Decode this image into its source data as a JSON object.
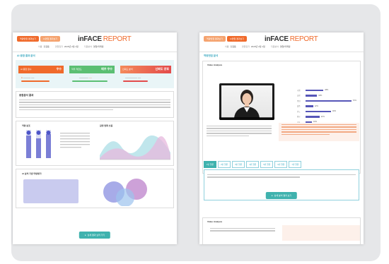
{
  "report": {
    "logo_main": "inFACE",
    "logo_report": "REPORT"
  },
  "left": {
    "tabs": [
      "역량면접 결과보기",
      "AI면접 결과보기"
    ],
    "meta": [
      {
        "k": "이름",
        "v": "홍길동"
      },
      {
        "k": "면접일자",
        "v": "2020년 2월 1일"
      },
      {
        "k": "지원분야",
        "v": "영업/마케팅"
      }
    ],
    "section": "AI 종합 결과 분석",
    "scores": [
      {
        "label": "AI 종합 점수",
        "value": "우수"
      },
      {
        "label": "직무 적합도",
        "value": "매우 우수"
      },
      {
        "label": "신뢰도 분석",
        "value": "신뢰도 양호"
      }
    ],
    "summary_title": "종합분석 결과",
    "chart1_title": "역량 분포",
    "chart2_title": "감정 변화 흐름",
    "venn_title": "성향 분석",
    "bottom_title": "AI 분석 기반 역량평가",
    "button": "상세 결과 보러 가기",
    "venn_labels": [
      "성향 A",
      "성향 B",
      "성향 C"
    ],
    "bar_pct": [
      62,
      78,
      54
    ]
  },
  "right": {
    "tabs": [
      "역량면접 결과보기",
      "AI면접 결과보기"
    ],
    "meta": [
      {
        "k": "이름",
        "v": "홍길동"
      },
      {
        "k": "면접일자",
        "v": "2020년 2월 1일"
      },
      {
        "k": "지원분야",
        "v": "영업/마케팅"
      }
    ],
    "section": "역량면접 분석",
    "video_title": "Video Analysis",
    "question_tabs": [
      "1번 질문",
      "2번 질문",
      "3번 질문",
      "4번 질문",
      "5번 질문",
      "6번 질문",
      "7번 질문"
    ],
    "button": "상세 분석 결과 보기",
    "bottom_title": "Video Analysis",
    "emotion_bars": [
      {
        "label": "기쁨",
        "pct": 28
      },
      {
        "label": "놀람",
        "pct": 18
      },
      {
        "label": "중립",
        "pct": 72
      },
      {
        "label": "슬픔",
        "pct": 12
      },
      {
        "label": "분노",
        "pct": 40
      },
      {
        "label": "혐오",
        "pct": 22
      },
      {
        "label": "공포",
        "pct": 10
      },
      {
        "label": "경멸",
        "pct": 16
      }
    ]
  },
  "colors": {
    "accent": "#f06a2b",
    "teal": "#3fb2ae",
    "purple": "#5656b8"
  }
}
